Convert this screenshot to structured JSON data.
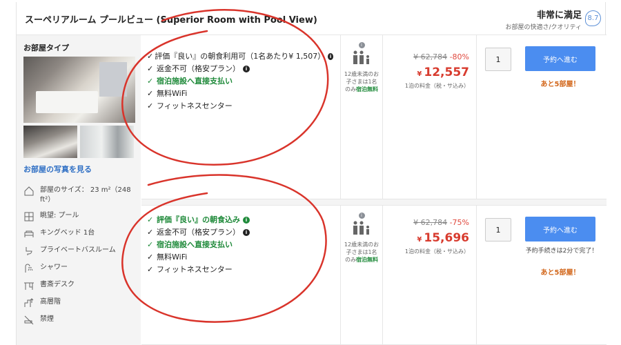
{
  "header": {
    "room_title": "スーペリアルーム プールビュー (Superior Room with Pool View)",
    "rating_word": "非常に満足",
    "rating_sub": "お部屋の快適さ/クオリティ",
    "score": "8.7"
  },
  "room_panel": {
    "heading": "お部屋タイプ",
    "photos_link": "お部屋の写真を見る",
    "features": [
      {
        "icon": "room-size-icon",
        "label": "部屋のサイズ： 23 m²（248 ft²）"
      },
      {
        "icon": "view-icon",
        "label": "眺望: プール"
      },
      {
        "icon": "bed-icon",
        "label": "キングベッド 1台"
      },
      {
        "icon": "bathroom-icon",
        "label": "プライベートバスルーム"
      },
      {
        "icon": "shower-icon",
        "label": "シャワー"
      },
      {
        "icon": "desk-icon",
        "label": "書斎デスク"
      },
      {
        "icon": "high-floor-icon",
        "label": "高層階"
      },
      {
        "icon": "no-smoking-icon",
        "label": "禁煙"
      }
    ]
  },
  "offers": [
    {
      "benefits": [
        {
          "text": "評価『良い』の朝食利用可（1名あたり¥ 1,507）",
          "green": false,
          "info": true
        },
        {
          "text": "返金不可（格安プラン）",
          "green": false,
          "info": true
        },
        {
          "text": "宿泊施設へ直接支払い",
          "green": true,
          "info": false
        },
        {
          "text": "無料WiFi",
          "green": false,
          "info": false
        },
        {
          "text": "フィットネスセンター",
          "green": false,
          "info": false
        }
      ],
      "occupancy_text": "12歳未満のお子さまは1名のみ",
      "occupancy_free": "宿泊無料",
      "price_old": "¥ 62,784",
      "discount": "-80%",
      "currency": "¥",
      "price_new": "12,557",
      "price_note": "1泊の料金（税・サ込み）",
      "quantity": "1",
      "book_label": "予約へ進む",
      "rooms_left": "あと5部屋！",
      "fast_note": ""
    },
    {
      "benefits": [
        {
          "text": "評価『良い』の朝食込み",
          "green": true,
          "info": true
        },
        {
          "text": "返金不可（格安プラン）",
          "green": false,
          "info": true
        },
        {
          "text": "宿泊施設へ直接支払い",
          "green": true,
          "info": false
        },
        {
          "text": "無料WiFi",
          "green": false,
          "info": false
        },
        {
          "text": "フィットネスセンター",
          "green": false,
          "info": false
        }
      ],
      "occupancy_text": "12歳未満のお子さまは1名のみ",
      "occupancy_free": "宿泊無料",
      "price_old": "¥ 62,784",
      "discount": "-75%",
      "currency": "¥",
      "price_new": "15,696",
      "price_note": "1泊の料金（税・サ込み）",
      "quantity": "1",
      "book_label": "予約へ進む",
      "rooms_left": "あと5部屋！",
      "fast_note": "予約手続きは2分で完了！"
    }
  ],
  "colors": {
    "accent_blue": "#4b8df0",
    "price_red": "#d83b2e",
    "benefit_green": "#1f8a3a",
    "scarcity_orange": "#d2661a",
    "annotation_red": "#d9342b"
  }
}
